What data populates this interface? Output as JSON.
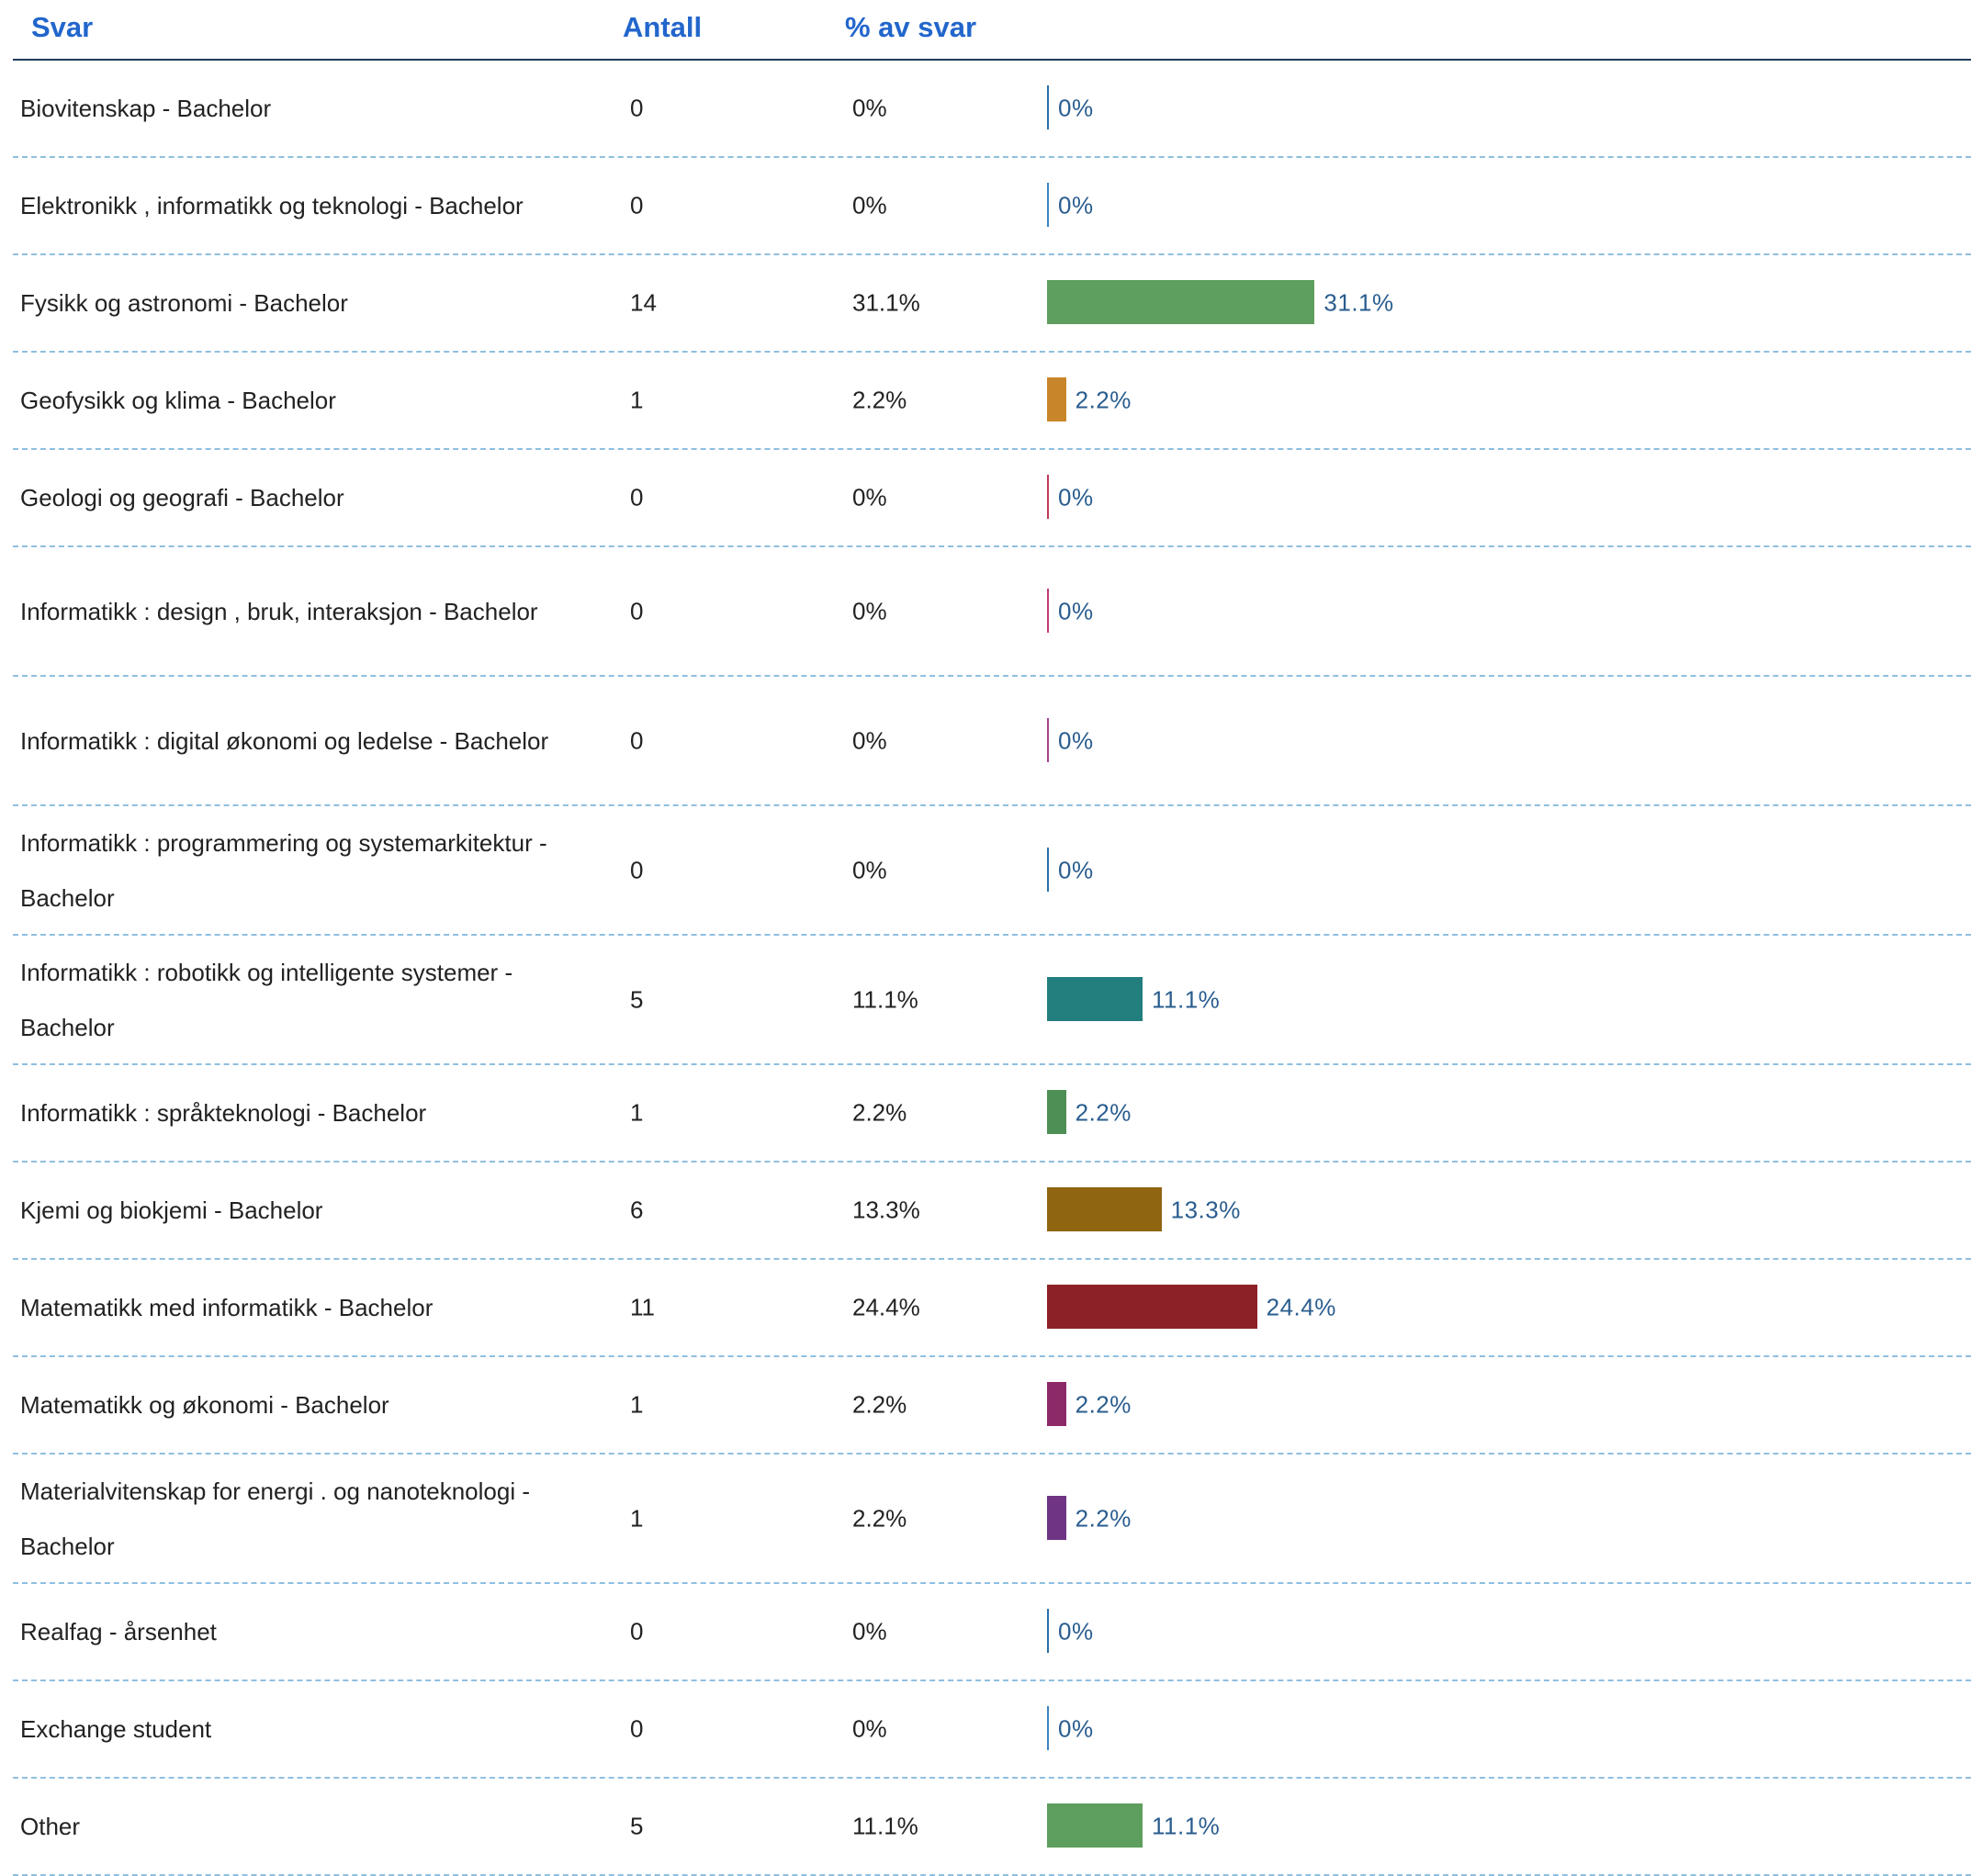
{
  "header": {
    "svar": "Svar",
    "antall": "Antall",
    "pct": "% av svar"
  },
  "chart_data": {
    "type": "bar",
    "orientation": "horizontal",
    "columns": [
      "Svar",
      "Antall",
      "% av svar"
    ],
    "rows": [
      {
        "label": "Biovitenskap  - Bachelor",
        "count": "0",
        "pct_text": "0%",
        "pct": 0,
        "color": "#2a6fa8"
      },
      {
        "label": "Elektronikk , informatikk  og teknologi  - Bachelor",
        "count": "0",
        "pct_text": "0%",
        "pct": 0,
        "color": "#3b83c0"
      },
      {
        "label": "Fysikk og astronomi  - Bachelor",
        "count": "14",
        "pct_text": "31.1%",
        "pct": 31.1,
        "color": "#5e9e5e"
      },
      {
        "label": "Geofysikk  og klima - Bachelor",
        "count": "1",
        "pct_text": "2.2%",
        "pct": 2.2,
        "color": "#c8862a"
      },
      {
        "label": "Geologi  og geografi - Bachelor",
        "count": "0",
        "pct_text": "0%",
        "pct": 0,
        "color": "#c0395a"
      },
      {
        "label": "Informatikk : design , bruk, interaksjon  - Bachelor",
        "count": "0",
        "pct_text": "0%",
        "pct": 0,
        "color": "#c0397a"
      },
      {
        "label": "Informatikk : digital  økonomi  og ledelse  - Bachelor",
        "count": "0",
        "pct_text": "0%",
        "pct": 0,
        "color": "#a4408f"
      },
      {
        "label": "Informatikk : programmering  og systemarkitektur  - Bachelor",
        "count": "0",
        "pct_text": "0%",
        "pct": 0,
        "color": "#2a6fa8"
      },
      {
        "label": "Informatikk : robotikk  og intelligente  systemer  - Bachelor",
        "count": "5",
        "pct_text": "11.1%",
        "pct": 11.1,
        "color": "#237e7e"
      },
      {
        "label": "Informatikk : språkteknologi  - Bachelor",
        "count": "1",
        "pct_text": "2.2%",
        "pct": 2.2,
        "color": "#4e8f56"
      },
      {
        "label": "Kjemi og biokjemi  - Bachelor",
        "count": "6",
        "pct_text": "13.3%",
        "pct": 13.3,
        "color": "#8f6510"
      },
      {
        "label": "Matematikk  med informatikk  - Bachelor",
        "count": "11",
        "pct_text": "24.4%",
        "pct": 24.4,
        "color": "#8c2127"
      },
      {
        "label": "Matematikk  og økonomi  - Bachelor",
        "count": "1",
        "pct_text": "2.2%",
        "pct": 2.2,
        "color": "#8c2a68"
      },
      {
        "label": "Materialvitenskap   for energi . og nanoteknologi  - Bachelor",
        "count": "1",
        "pct_text": "2.2%",
        "pct": 2.2,
        "color": "#6f3484"
      },
      {
        "label": "Realfag  - årsenhet",
        "count": "0",
        "pct_text": "0%",
        "pct": 0,
        "color": "#2a6fa8"
      },
      {
        "label": "Exchange  student",
        "count": "0",
        "pct_text": "0%",
        "pct": 0,
        "color": "#3b83c0"
      },
      {
        "label": "Other",
        "count": "5",
        "pct_text": "11.1%",
        "pct": 11.1,
        "color": "#5e9e5e"
      }
    ]
  }
}
